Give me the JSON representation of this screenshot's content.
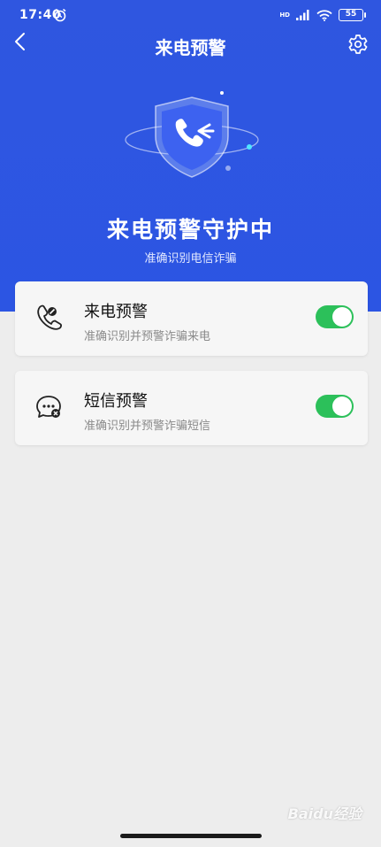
{
  "status": {
    "time": "17:40",
    "battery": "55",
    "network": "HD"
  },
  "nav": {
    "title": "来电预警"
  },
  "hero": {
    "title": "来电预警守护中",
    "subtitle": "准确识别电信诈骗"
  },
  "cards": [
    {
      "title": "来电预警",
      "desc": "准确识别并预警诈骗来电",
      "enabled": true,
      "icon": "phone-warning-icon"
    },
    {
      "title": "短信预警",
      "desc": "准确识别并预警诈骗短信",
      "enabled": true,
      "icon": "message-warning-icon"
    }
  ],
  "colors": {
    "brand_blue": "#2c55e3",
    "toggle_on": "#2cc05a",
    "background": "#ededed"
  },
  "watermark": "Baidu经验"
}
